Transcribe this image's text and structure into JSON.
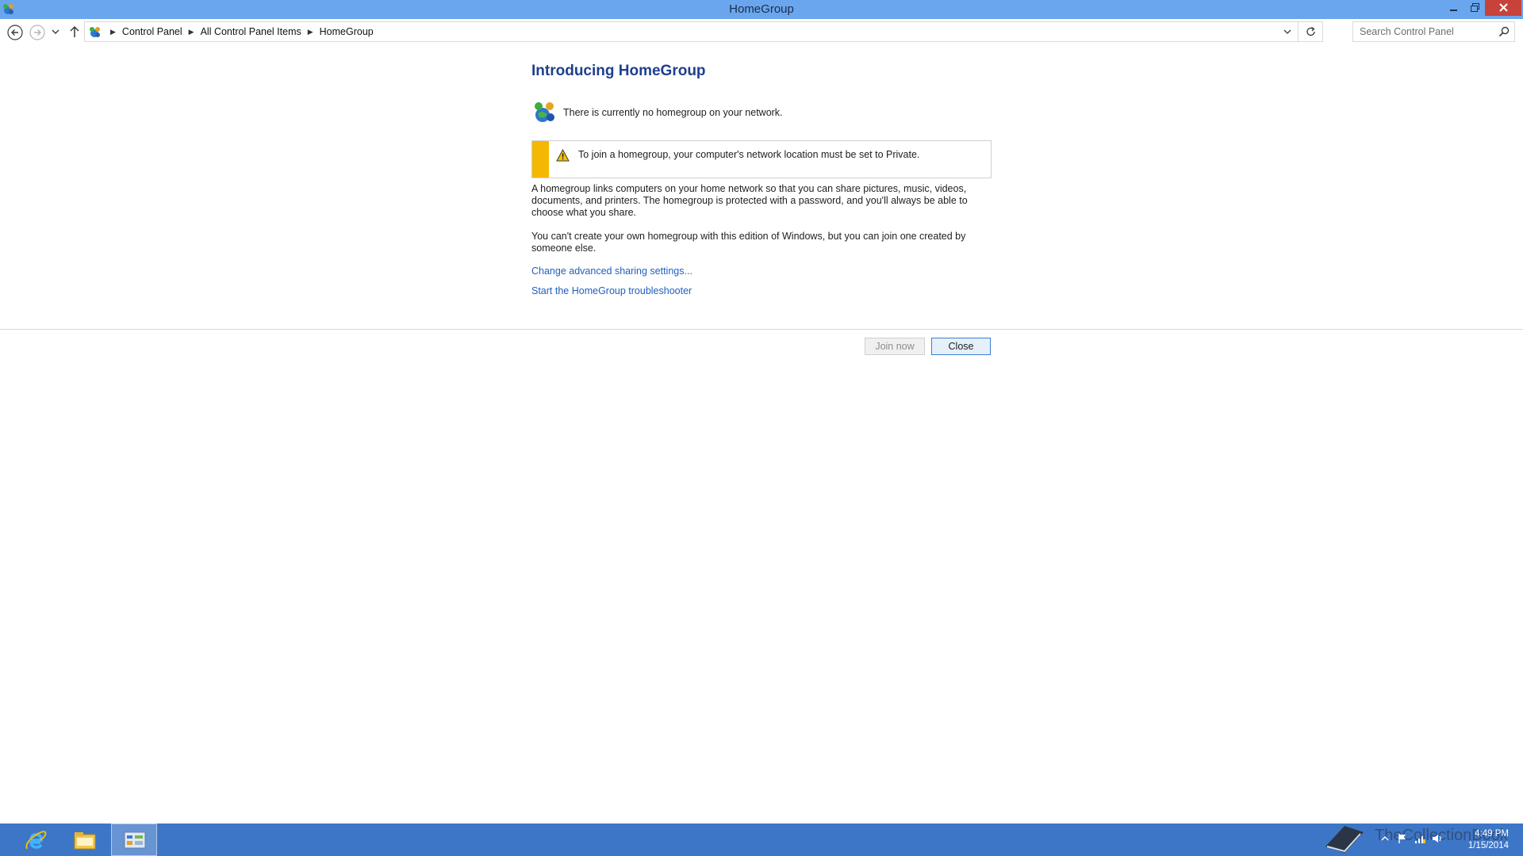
{
  "window": {
    "title": "HomeGroup",
    "app_icon": "homegroup-icon"
  },
  "addressbar": {
    "crumbs": [
      "Control Panel",
      "All Control Panel Items",
      "HomeGroup"
    ],
    "search_placeholder": "Search Control Panel"
  },
  "main": {
    "heading": "Introducing HomeGroup",
    "status_text": "There is currently no homegroup on your network.",
    "warning_text": "To join a homegroup, your computer's network location must be set to Private.",
    "paragraph1": "A homegroup links computers on your home network so that you can share pictures, music, videos, documents, and printers. The homegroup is protected with a password, and you'll always be able to choose what you share.",
    "paragraph2": "You can't create your own homegroup with this edition of Windows, but you can join one created by someone else.",
    "link_advanced": "Change advanced sharing settings...",
    "link_troubleshooter": "Start the HomeGroup troubleshooter"
  },
  "buttons": {
    "join_label": "Join now",
    "join_enabled": false,
    "close_label": "Close"
  },
  "taskbar": {
    "items": [
      "internet-explorer-icon",
      "file-explorer-icon",
      "control-panel-icon"
    ],
    "watermark_text": "TheCollectionBook",
    "clock_time": "4:49 PM",
    "clock_date": "1/15/2014"
  },
  "colors": {
    "titlebar": "#6aa6ee",
    "taskbar": "#3d76c6",
    "heading": "#1e3f8f",
    "link": "#1f5fbf",
    "warning_bar": "#f5b800",
    "close_button": "#c7423a"
  }
}
